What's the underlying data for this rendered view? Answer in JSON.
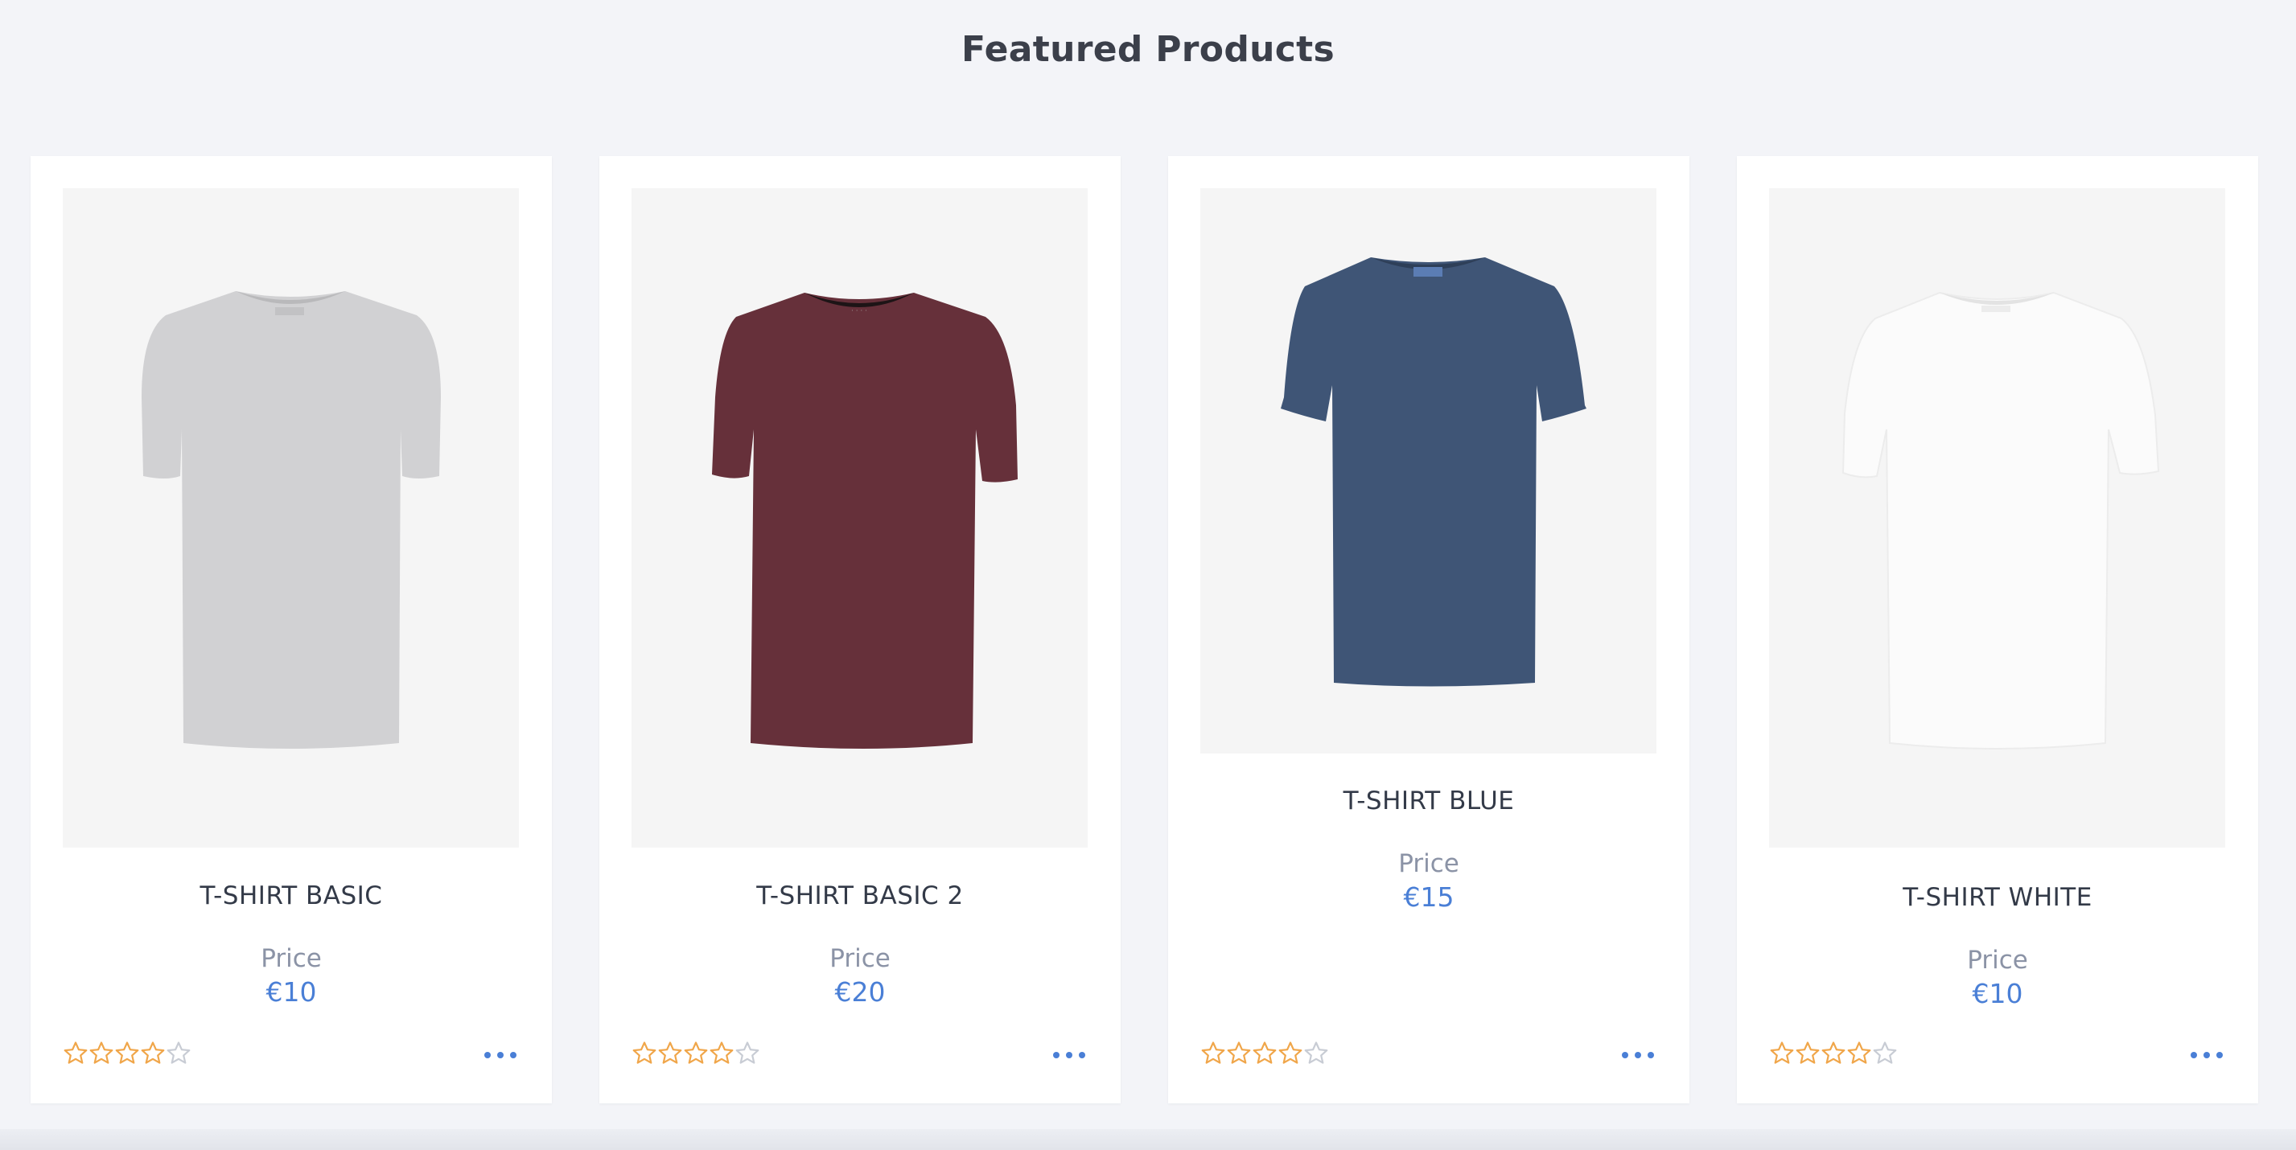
{
  "section": {
    "title": "Featured Products"
  },
  "colors": {
    "background": "#f3f4f8",
    "accent": "#4a7fd6",
    "star": "#f0a64a",
    "star_empty": "#c8ccd4"
  },
  "products": [
    {
      "name": "T-SHIRT BASIC",
      "price_label": "Price",
      "price": "€10",
      "rating": 4,
      "rating_max": 5,
      "image_icon": "gray-tshirt-image",
      "shirt_color": "#d1d1d3"
    },
    {
      "name": "T-SHIRT BASIC 2",
      "price_label": "Price",
      "price": "€20",
      "rating": 4,
      "rating_max": 5,
      "image_icon": "maroon-tshirt-image",
      "shirt_color": "#66303a"
    },
    {
      "name": "T-SHIRT BLUE",
      "price_label": "Price",
      "price": "€15",
      "rating": 4,
      "rating_max": 5,
      "image_icon": "navy-tshirt-image",
      "shirt_color": "#3f5576"
    },
    {
      "name": "T-SHIRT WHITE",
      "price_label": "Price",
      "price": "€10",
      "rating": 4,
      "rating_max": 5,
      "image_icon": "white-tshirt-image",
      "shirt_color": "#fbfbfb"
    }
  ]
}
